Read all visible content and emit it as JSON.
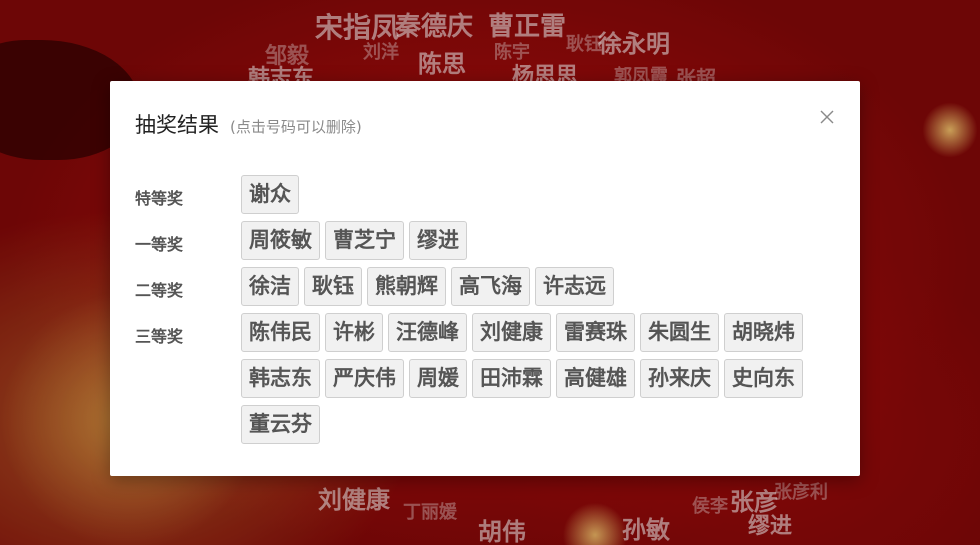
{
  "dialog": {
    "title": "抽奖结果",
    "hint": "(点击号码可以删除)",
    "close_icon": "close-icon"
  },
  "tiers": [
    {
      "label": "特等奖",
      "winners": [
        "谢众"
      ]
    },
    {
      "label": "一等奖",
      "winners": [
        "周筱敏",
        "曹芝宁",
        "缪进"
      ]
    },
    {
      "label": "二等奖",
      "winners": [
        "徐洁",
        "耿钰",
        "熊朝辉",
        "高飞海",
        "许志远"
      ]
    },
    {
      "label": "三等奖",
      "winners": [
        "陈伟民",
        "许彬",
        "汪德峰",
        "刘健康",
        "雷赛珠",
        "朱圆生",
        "胡晓炜",
        "韩志东",
        "严庆伟",
        "周媛",
        "田沛霖",
        "高健雄",
        "孙来庆",
        "史向东",
        "董云芬"
      ]
    }
  ],
  "background_names": [
    "宋指凤",
    "秦德庆",
    "曹正雷",
    "徐永明",
    "邹毅",
    "刘洋",
    "陈思",
    "陈宇",
    "耿钰",
    "韩志东",
    "杨思思",
    "郭凤霞",
    "张超",
    "刘健康",
    "丁丽媛",
    "胡伟",
    "孙敏",
    "张彦",
    "缪进",
    "侯李",
    "张彦利"
  ],
  "colors": {
    "background_red": "#8c0a0a",
    "dialog_bg": "#ffffff",
    "chip_bg": "#f1f1f1",
    "chip_border": "#cfcfcf",
    "chip_text": "#555555"
  }
}
